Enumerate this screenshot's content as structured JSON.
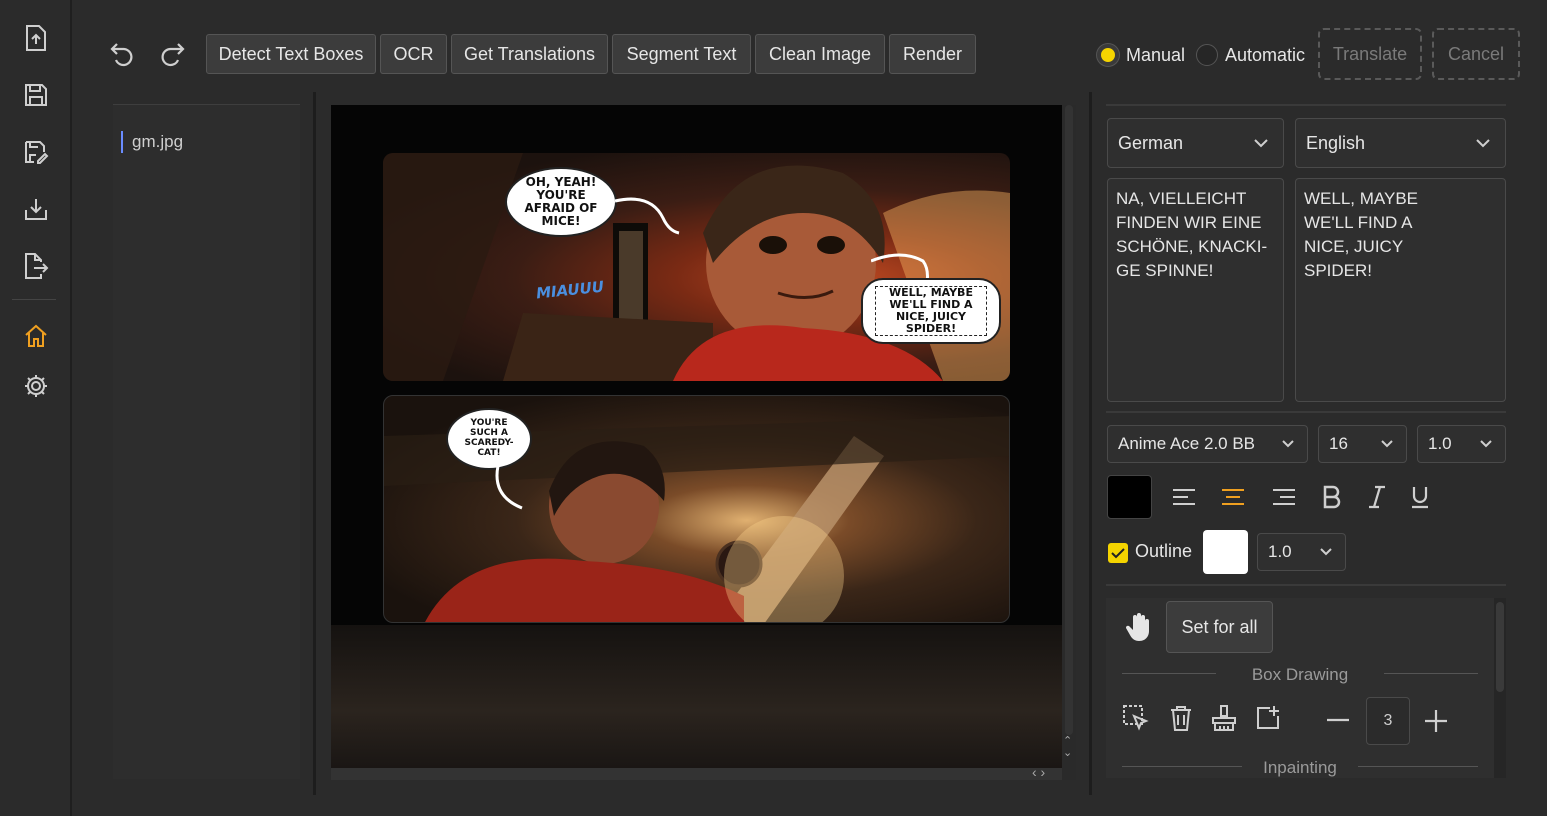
{
  "toolbar": {
    "undo_icon": "undo-icon",
    "redo_icon": "redo-icon",
    "buttons": [
      "Detect Text Boxes",
      "OCR",
      "Get Translations",
      "Segment Text",
      "Clean Image",
      "Render"
    ],
    "mode_manual": "Manual",
    "mode_automatic": "Automatic",
    "translate": "Translate",
    "cancel": "Cancel"
  },
  "files": {
    "items": [
      "gm.jpg"
    ]
  },
  "comic": {
    "bubble1": "OH, YEAH! YOU'RE AFRAID OF MICE!",
    "bubble2": "WELL, MAYBE WE'LL FIND A NICE, JUICY SPIDER!",
    "bubble3": "YOU'RE SUCH A SCAREDY-CAT!",
    "sfx": "MIAUUU"
  },
  "translation": {
    "source_lang": "German",
    "target_lang": "English",
    "source_text": "NA, VIELLEICHT\nFINDEN WIR EINE\nSCHÖNE, KNACKI-\nGE SPINNE!",
    "target_text": "WELL, MAYBE\nWE'LL FIND A\nNICE, JUICY\nSPIDER!"
  },
  "format": {
    "font": "Anime Ace 2.0 BB",
    "size": "16",
    "line_spacing": "1.0",
    "text_color": "#000000",
    "outline_label": "Outline",
    "outline_color": "#ffffff",
    "outline_width": "1.0"
  },
  "tools": {
    "set_for_all": "Set for all",
    "box_drawing_label": "Box Drawing",
    "brush_size": "3",
    "inpainting_label": "Inpainting"
  },
  "colors": {
    "accent": "#f0a020",
    "radio_on": "#f5d400"
  }
}
